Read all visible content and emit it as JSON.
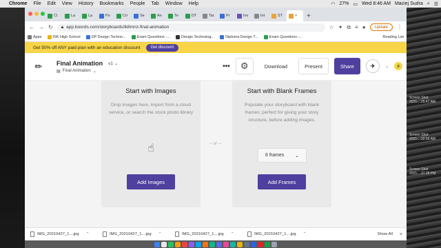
{
  "menubar": {
    "items": [
      "Chrome",
      "File",
      "Edit",
      "View",
      "History",
      "Bookmarks",
      "People",
      "Tab",
      "Window",
      "Help"
    ],
    "clock": "Wed 8:46 AM",
    "battery": "27%",
    "user": "Maciej Sudra"
  },
  "desktop": {
    "files": [
      "Screen Shot 2021-...25.47 AM",
      "Screen Shot 2021-...32.59 AM",
      "Screen Shot 2021-...37.28 PM"
    ]
  },
  "tabs": [
    "Cl",
    "La",
    "La",
    "Po",
    "Cri",
    "Se",
    "An",
    "Te",
    "DT",
    "Tar",
    "Pr",
    "Inv",
    "Int",
    "ST"
  ],
  "toolbar": {
    "url": "app.boords.com/storyboards/lk8mnz-final-animation",
    "update_label": "Update"
  },
  "bookmarks": {
    "items": [
      "Apps",
      "ISK High School",
      "DP Design Techno...",
      "Exam Questions -...",
      "Design Technolog...",
      "Diploma Design T...",
      "Exam Questions -..."
    ],
    "reading_list": "Reading List"
  },
  "promo": {
    "text": "Get 50% off ANY paid plan with an education discount",
    "button": "Get discount"
  },
  "header": {
    "title": "Final Animation",
    "version": "v1",
    "subtitle": "Final Animation",
    "download": "Download",
    "present": "Present",
    "share": "Share"
  },
  "images_card": {
    "title": "Start with Images",
    "description": "Drop images here, import from a cloud service, or search the stock photo library",
    "button": "Add Images"
  },
  "or_text": "– or –",
  "frames_card": {
    "title": "Start with Blank Frames",
    "description": "Populate your storyboard with blank frames; perfect for giving your story structure, before adding images.",
    "select_value": "6 frames",
    "button": "Add Frames"
  },
  "downloads": {
    "items": [
      "IMG_20210427_1....jpg",
      "IMG_20210427_1....jpg",
      "IMG_20210427_1....jpg",
      "IMG_20210427_1....jpg"
    ],
    "show_all": "Show All"
  }
}
